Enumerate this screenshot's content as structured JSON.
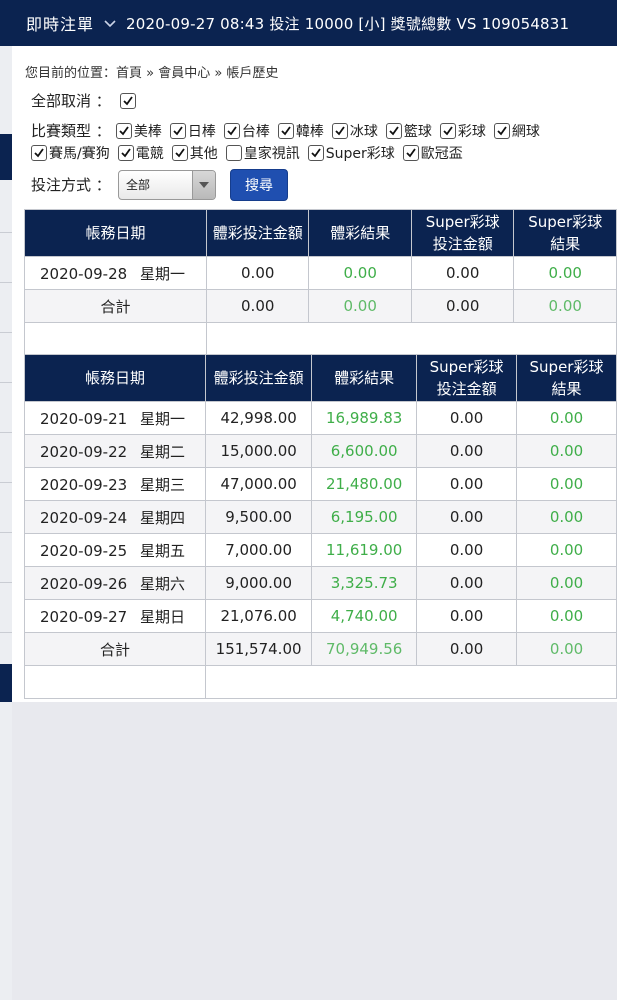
{
  "topbar": {
    "title": "即時注單",
    "ticker": "2020-09-27 08:43 投注 10000 [小] 獎號總數 VS 109054831"
  },
  "breadcrumb": "您目前的位置：首頁 » 會員中心 » 帳戶歷史",
  "filters": {
    "all_cancel_label": "全部取消 ：",
    "type_label": "比賽類型 ：",
    "types_row1": [
      {
        "label": "美棒",
        "checked": true
      },
      {
        "label": "日棒",
        "checked": true
      },
      {
        "label": "台棒",
        "checked": true
      },
      {
        "label": "韓棒",
        "checked": true
      },
      {
        "label": "冰球",
        "checked": true
      },
      {
        "label": "籃球",
        "checked": true
      },
      {
        "label": "彩球",
        "checked": true
      },
      {
        "label": "網球",
        "checked": true
      }
    ],
    "types_row2": [
      {
        "label": "賽馬/賽狗",
        "checked": true
      },
      {
        "label": "電競",
        "checked": true
      },
      {
        "label": "其他",
        "checked": true
      },
      {
        "label": "皇家視訊",
        "checked": false
      },
      {
        "label": "Super彩球",
        "checked": true
      },
      {
        "label": "歐冠盃",
        "checked": true
      }
    ],
    "method_label": "投注方式 ：",
    "method_value": "全部",
    "search_label": "搜尋"
  },
  "headers": {
    "date": "帳務日期",
    "sport_bet": "體彩投注金額",
    "sport_result": "體彩結果",
    "super_bet_1": "Super彩球",
    "super_bet_2": "投注金額",
    "super_result_1": "Super彩球",
    "super_result_2": "結果"
  },
  "table1": {
    "rows": [
      {
        "date": "2020-09-28 星期一",
        "sport_bet": "0.00",
        "sport_result": "0.00",
        "super_bet": "0.00",
        "super_result": "0.00"
      }
    ],
    "total": {
      "label": "合計",
      "sport_bet": "0.00",
      "sport_result": "0.00",
      "super_bet": "0.00",
      "super_result": "0.00"
    }
  },
  "table2": {
    "rows": [
      {
        "date": "2020-09-21 星期一",
        "sport_bet": "42,998.00",
        "sport_result": "16,989.83",
        "super_bet": "0.00",
        "super_result": "0.00"
      },
      {
        "date": "2020-09-22 星期二",
        "sport_bet": "15,000.00",
        "sport_result": "6,600.00",
        "super_bet": "0.00",
        "super_result": "0.00"
      },
      {
        "date": "2020-09-23 星期三",
        "sport_bet": "47,000.00",
        "sport_result": "21,480.00",
        "super_bet": "0.00",
        "super_result": "0.00"
      },
      {
        "date": "2020-09-24 星期四",
        "sport_bet": "9,500.00",
        "sport_result": "6,195.00",
        "super_bet": "0.00",
        "super_result": "0.00"
      },
      {
        "date": "2020-09-25 星期五",
        "sport_bet": "7,000.00",
        "sport_result": "11,619.00",
        "super_bet": "0.00",
        "super_result": "0.00"
      },
      {
        "date": "2020-09-26 星期六",
        "sport_bet": "9,000.00",
        "sport_result": "3,325.73",
        "super_bet": "0.00",
        "super_result": "0.00"
      },
      {
        "date": "2020-09-27 星期日",
        "sport_bet": "21,076.00",
        "sport_result": "4,740.00",
        "super_bet": "0.00",
        "super_result": "0.00"
      }
    ],
    "total": {
      "label": "合計",
      "sport_bet": "151,574.00",
      "sport_result": "70,949.56",
      "super_bet": "0.00",
      "super_result": "0.00"
    }
  },
  "colors": {
    "navy": "#0b2350",
    "positive_green": "#3fae49",
    "button_blue": "#1f4fb0"
  }
}
